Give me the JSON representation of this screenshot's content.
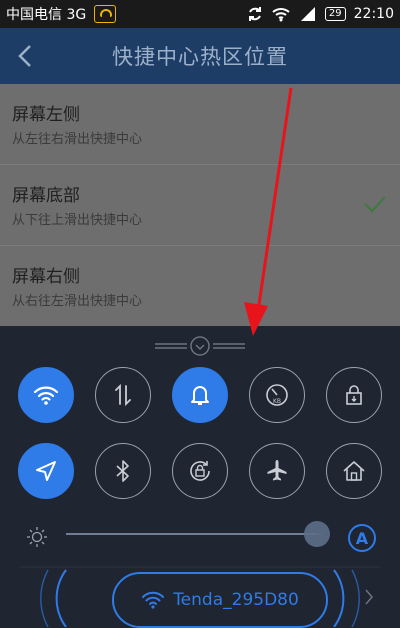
{
  "status_bar": {
    "carrier": "中国电信 3G",
    "battery": "29",
    "time": "22:10"
  },
  "header": {
    "title": "快捷中心热区位置",
    "back_icon": "chevron-left-icon"
  },
  "options": [
    {
      "title": "屏幕左侧",
      "subtitle": "从左往右滑出快捷中心",
      "selected": false
    },
    {
      "title": "屏幕底部",
      "subtitle": "从下往上滑出快捷中心",
      "selected": true
    },
    {
      "title": "屏幕右侧",
      "subtitle": "从右往左滑出快捷中心",
      "selected": false
    }
  ],
  "control_panel": {
    "toggles_row1": [
      {
        "icon": "wifi-icon",
        "on": true
      },
      {
        "icon": "data-transfer-icon",
        "on": false
      },
      {
        "icon": "bell-icon",
        "on": true
      },
      {
        "icon": "speed-meter-icon",
        "on": false,
        "label": "KB"
      },
      {
        "icon": "lock-icon",
        "on": false
      }
    ],
    "toggles_row2": [
      {
        "icon": "location-arrow-icon",
        "on": true
      },
      {
        "icon": "bluetooth-icon",
        "on": false
      },
      {
        "icon": "rotation-lock-icon",
        "on": false
      },
      {
        "icon": "airplane-icon",
        "on": false
      },
      {
        "icon": "home-icon",
        "on": false
      }
    ],
    "brightness": {
      "level": 0.98,
      "auto_label": "A"
    },
    "wifi_network": "Tenda_295D80"
  },
  "colors": {
    "accent": "#2f7be8",
    "header_bg": "#1e3d66",
    "panel_bg": "#1f2531",
    "annotation": "#e8141c"
  }
}
